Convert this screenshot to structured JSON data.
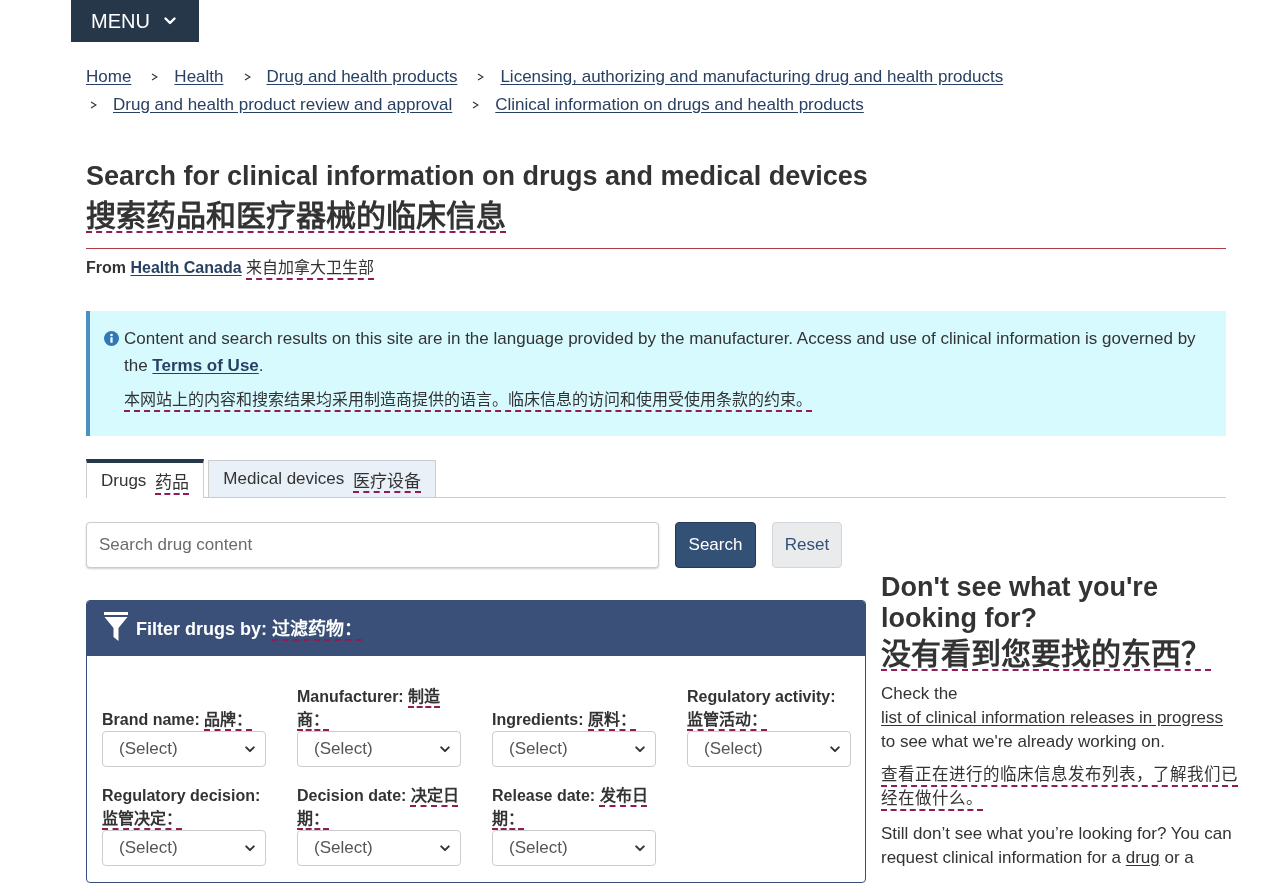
{
  "menu_button": {
    "label": "MENU"
  },
  "breadcrumbs": [
    {
      "label": "Home"
    },
    {
      "label": "Health"
    },
    {
      "label": "Drug and health products"
    },
    {
      "label": "Licensing, authorizing and manufacturing drug and health products"
    },
    {
      "label": "Drug and health product review and approval"
    },
    {
      "label": "Clinical information on drugs and health products"
    }
  ],
  "page_title": {
    "text": "Search for clinical information on drugs and medical devices",
    "translation": "搜索药品和医疗器械的临床信息"
  },
  "byline": {
    "prefix": "From",
    "link": "Health Canada",
    "translation": "来自加拿大卫生部"
  },
  "notice": {
    "text": "Content and search results on this site are in the language provided by the manufacturer. Access and use of clinical information is governed by the",
    "link": "Terms of Use",
    "suffix": ".",
    "translation": "本网站上的内容和搜索结果均采用制造商提供的语言。临床信息的访问和使用受使用条款的约束。"
  },
  "tabs": [
    {
      "label": "Drugs",
      "translation": "药品",
      "selected": true
    },
    {
      "label": "Medical devices",
      "translation": "医疗设备",
      "selected": false
    }
  ],
  "search": {
    "placeholder": "Search drug content",
    "buttons": [
      {
        "label": "Search",
        "kind": "primary"
      },
      {
        "label": "Reset",
        "kind": "secondary"
      }
    ]
  },
  "filter_panel": {
    "title": "Filter drugs by:",
    "translation": "过滤药物：",
    "fields": [
      {
        "label": "Brand name:",
        "translation": "品牌：",
        "value": "(Select)"
      },
      {
        "label": "Manufacturer:",
        "translation": "制造商：",
        "value": "(Select)"
      },
      {
        "label": "Ingredients:",
        "translation": "原料：",
        "value": "(Select)"
      },
      {
        "label": "Regulatory activity:",
        "translation": "监管活动：",
        "value": "(Select)"
      },
      {
        "label": "Regulatory decision:",
        "translation": "监管决定：",
        "value": "(Select)"
      },
      {
        "label": "Decision date:",
        "translation": "决定日期：",
        "value": "(Select)"
      },
      {
        "label": "Release date:",
        "translation": "发布日期：",
        "value": "(Select)"
      }
    ]
  },
  "sidebar": {
    "heading": "Don't see what you're looking for?",
    "heading_translation": "没有看到您要找的东西？",
    "paragraphs": [
      {
        "kind": "text",
        "before": "Check the",
        "link": "list of clinical information releases in progress",
        "after": "to see what we're already working on."
      },
      {
        "kind": "translation",
        "text": "查看正在进行的临床信息发布列表，了解我们已经在做什么。"
      },
      {
        "kind": "text",
        "before": "Still don’t see what you’re looking for? You can request clinical information for a",
        "link": "drug",
        "after": "or a"
      }
    ]
  }
}
